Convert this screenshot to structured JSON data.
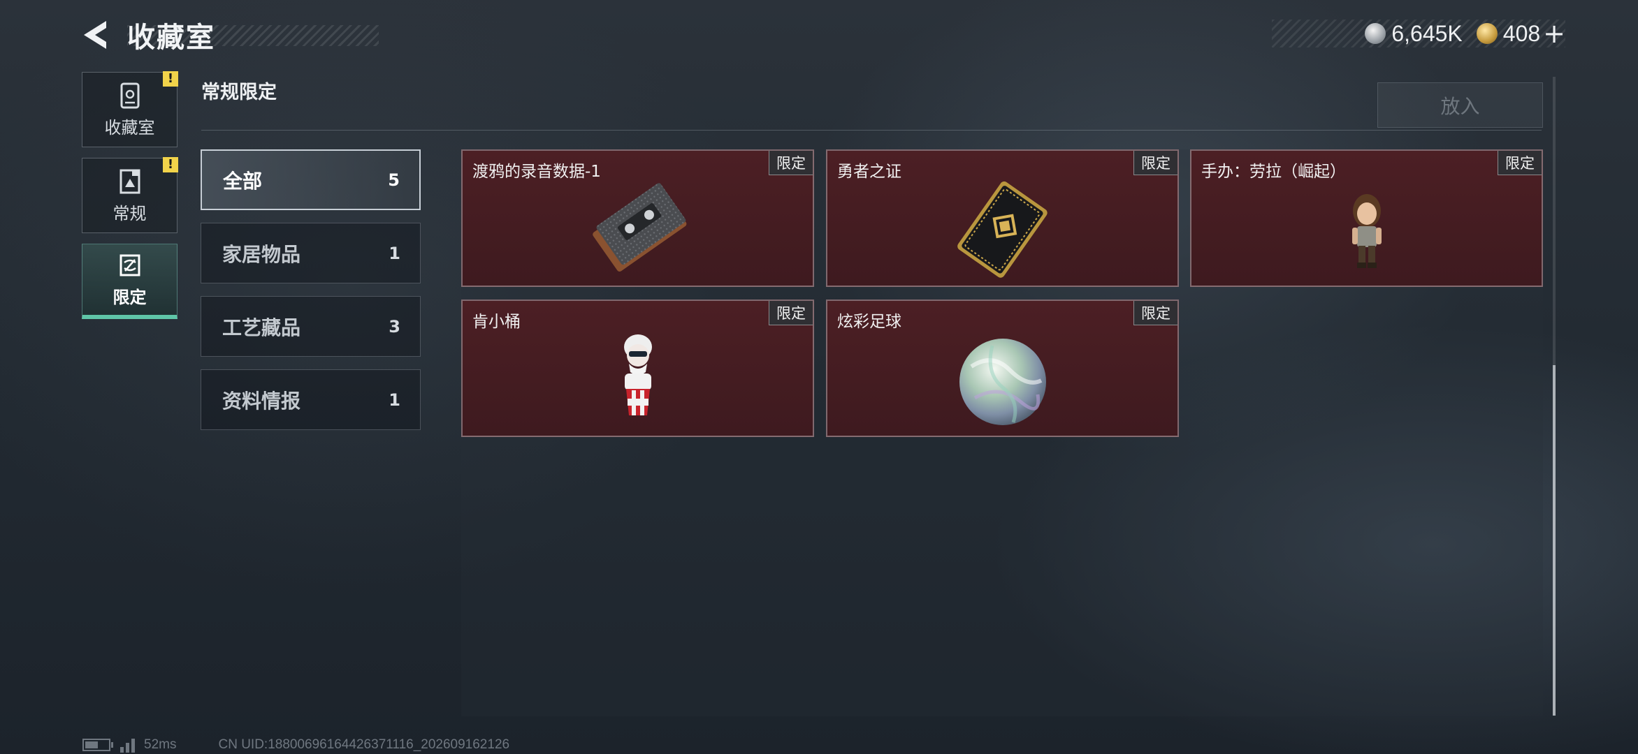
{
  "header": {
    "title": "收藏室",
    "currencies": [
      {
        "icon": "silver-coin-icon",
        "amount": "6,645K"
      },
      {
        "icon": "gold-coin-icon",
        "amount": "408"
      }
    ],
    "add_label": "+"
  },
  "side_tabs": [
    {
      "label": "收藏室",
      "icon": "collection-room-icon",
      "alert": "!",
      "active": false
    },
    {
      "label": "常规",
      "icon": "regular-icon",
      "alert": "!",
      "active": false
    },
    {
      "label": "限定",
      "icon": "limited-icon",
      "alert": "",
      "active": true
    }
  ],
  "section": {
    "title": "常规限定",
    "put_button": "放入"
  },
  "filters": [
    {
      "label": "全部",
      "count": "5",
      "active": true
    },
    {
      "label": "家居物品",
      "count": "1",
      "active": false
    },
    {
      "label": "工艺藏品",
      "count": "3",
      "active": false
    },
    {
      "label": "资料情报",
      "count": "1",
      "active": false
    }
  ],
  "items": [
    {
      "name": "渡鸦的录音数据-1",
      "tag": "限定",
      "icon": "cassette-tape-icon"
    },
    {
      "name": "勇者之证",
      "tag": "限定",
      "icon": "badge-card-icon"
    },
    {
      "name": "手办：劳拉（崛起）",
      "tag": "限定",
      "icon": "figure-lara-icon"
    },
    {
      "name": "肯小桶",
      "tag": "限定",
      "icon": "kfc-bucket-figure-icon"
    },
    {
      "name": "炫彩足球",
      "tag": "限定",
      "icon": "iridescent-ball-icon"
    }
  ],
  "status": {
    "battery_level": 0.55,
    "signal_bars": 3,
    "ping": "52ms",
    "uid": "CN UID:18800696164426371116_202609162126"
  },
  "colors": {
    "accent": "#5fc6a8",
    "card_bg": "#4c1f24",
    "alert": "#f1d34a"
  }
}
